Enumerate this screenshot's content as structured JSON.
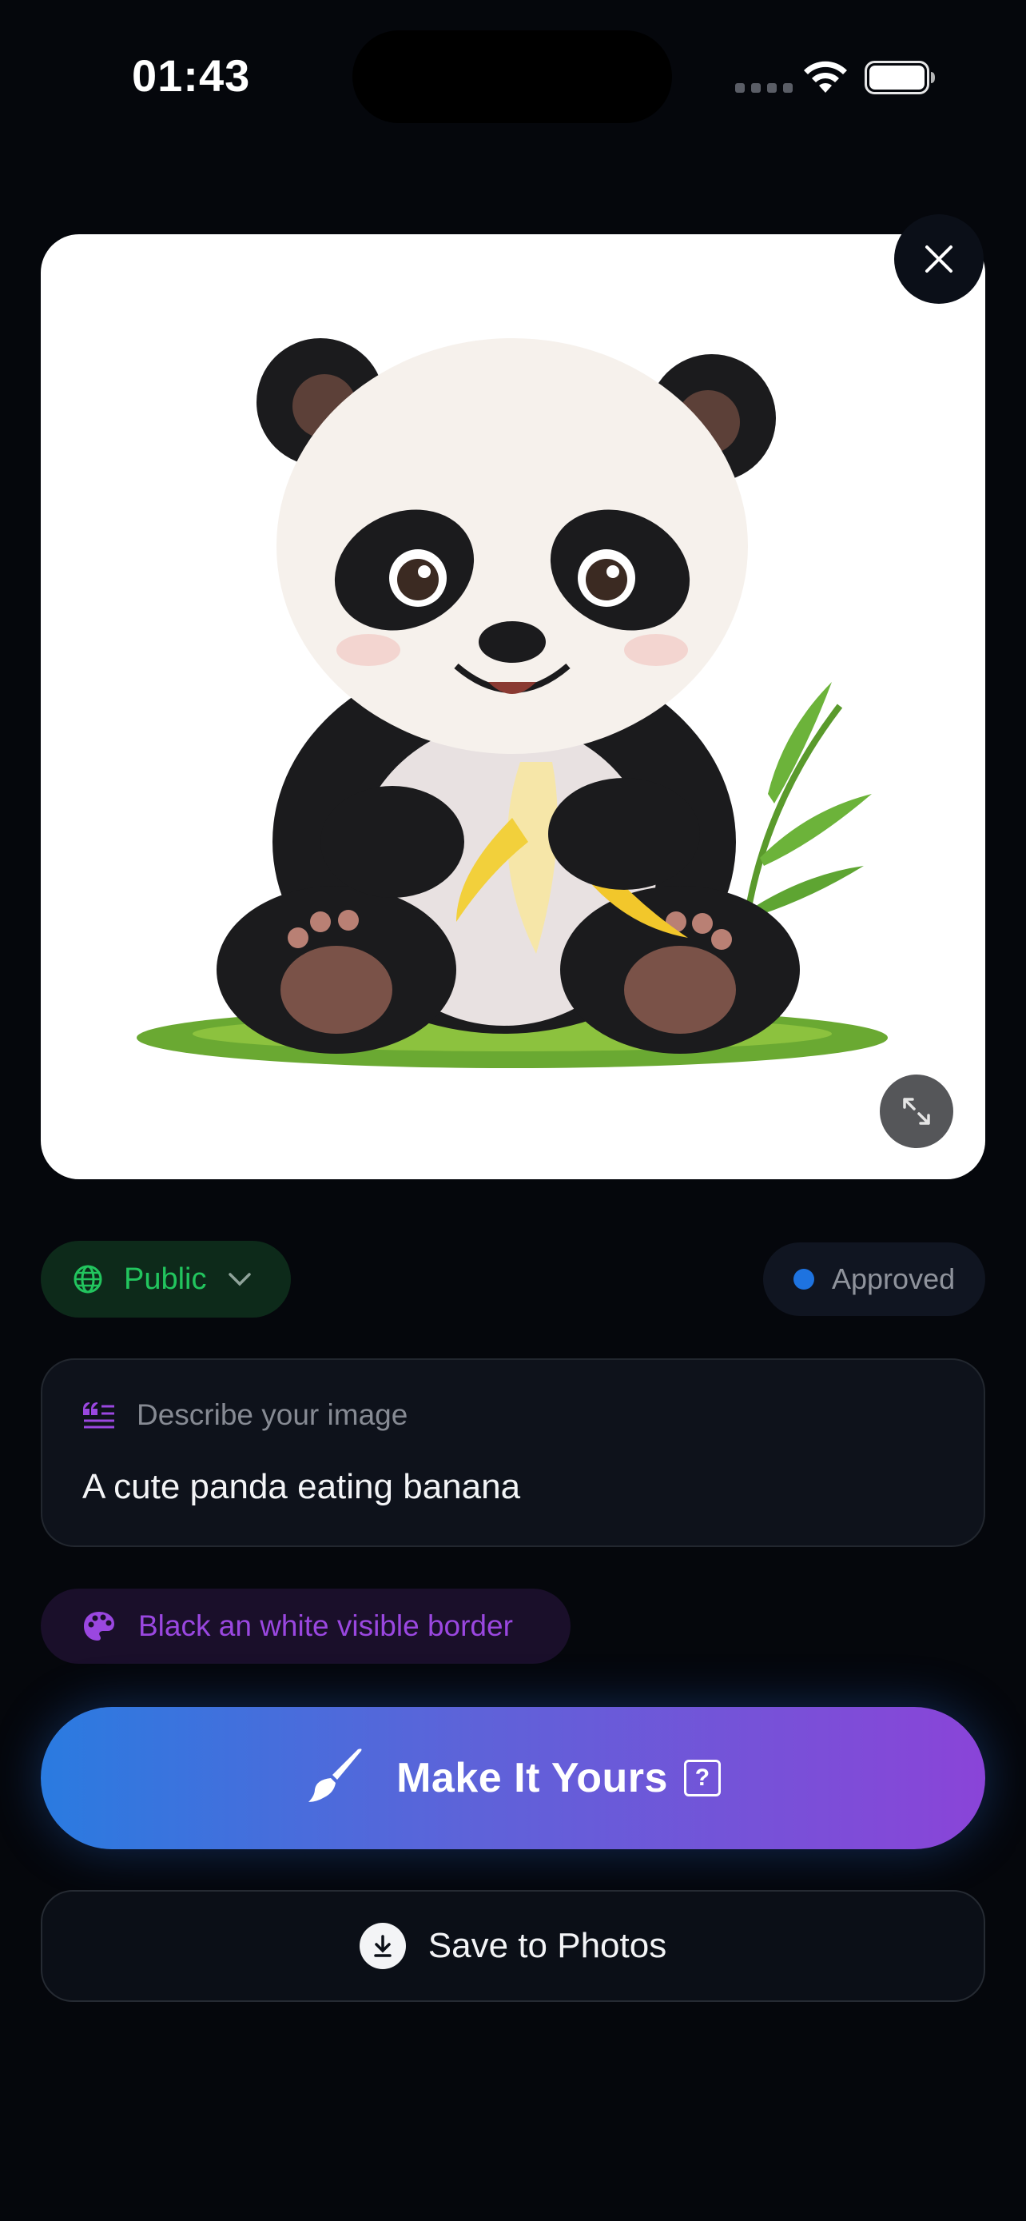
{
  "status_bar": {
    "time": "01:43"
  },
  "image": {
    "subject_icon": "panda-eating-banana-illustration"
  },
  "visibility": {
    "label": "Public",
    "icon": "globe-icon",
    "color": "#22c55e"
  },
  "moderation": {
    "label": "Approved",
    "dot_color": "#1e73e0"
  },
  "prompt": {
    "label": "Describe your image",
    "value": "A cute panda eating banana"
  },
  "style": {
    "label": "Black an white visible border",
    "icon": "palette-icon",
    "color": "#9a47e0"
  },
  "actions": {
    "make_label": "Make It Yours",
    "make_help": "?",
    "save_label": "Save to Photos"
  },
  "colors": {
    "background": "#05070c",
    "gradient_start": "#2a7be0",
    "gradient_end": "#8a44d8"
  }
}
